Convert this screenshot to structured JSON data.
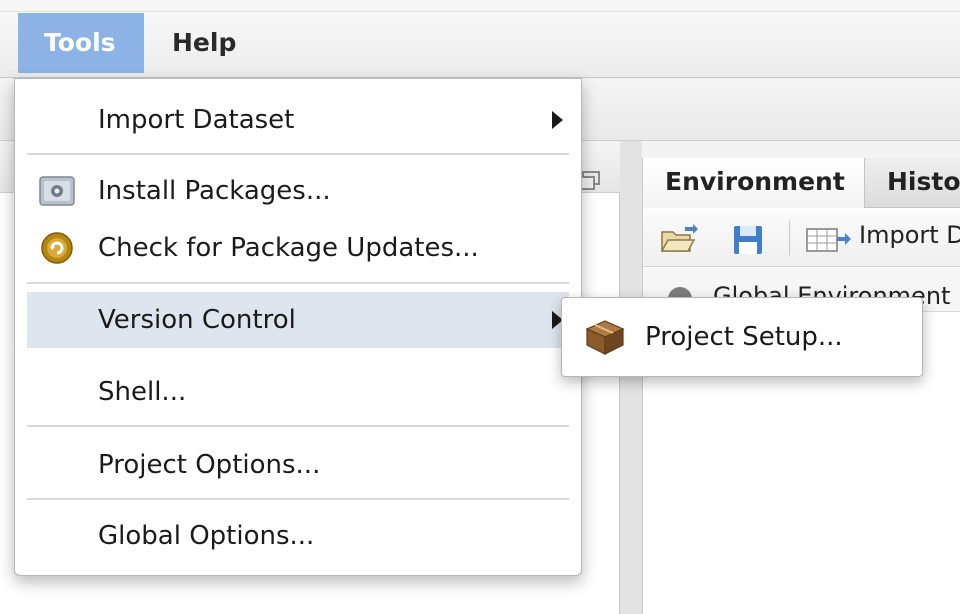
{
  "menubar": {
    "items": [
      {
        "label": "Tools",
        "active": true
      },
      {
        "label": "Help",
        "active": false
      }
    ]
  },
  "tools_menu": {
    "items": [
      {
        "label": "Import Dataset",
        "submenu": true
      },
      {
        "label": "Install Packages...",
        "icon": "install-package-icon"
      },
      {
        "label": "Check for Package Updates...",
        "icon": "package-update-icon"
      },
      {
        "label": "Version Control",
        "submenu": true,
        "highlighted": true
      },
      {
        "label": "Shell..."
      },
      {
        "label": "Project Options..."
      },
      {
        "label": "Global Options..."
      }
    ]
  },
  "version_control_submenu": {
    "items": [
      {
        "label": "Project Setup...",
        "icon": "project-box-icon"
      }
    ]
  },
  "right_pane": {
    "tabs": [
      "Environment",
      "Histo"
    ],
    "toolbar": {
      "icons": [
        "open-folder-icon",
        "save-disk-icon",
        "import-dataset-icon"
      ],
      "import_label": "Import D"
    },
    "environment_selector": "Global Environment"
  },
  "colors": {
    "menu_active_bg": "#8db2e6",
    "menu_item_highlight": "#dfe5ee",
    "package_icon_gold": "#b8860b",
    "project_box_brown": "#8a5a2b"
  }
}
